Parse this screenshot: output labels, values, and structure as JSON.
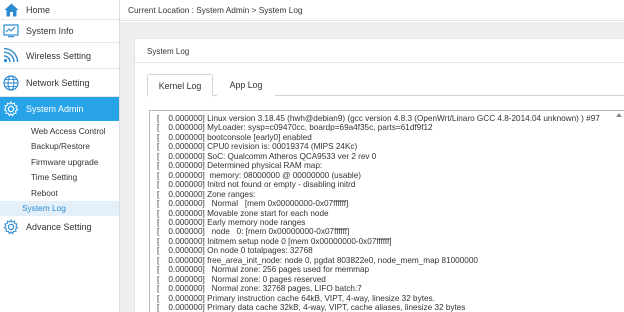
{
  "sidebar": {
    "items": [
      {
        "label": "Home",
        "icon": "home-icon"
      },
      {
        "label": "System Info",
        "icon": "monitor-icon"
      },
      {
        "label": "Wireless Setting",
        "icon": "wifi-icon"
      },
      {
        "label": "Network Setting",
        "icon": "globe-icon"
      },
      {
        "label": "System Admin",
        "icon": "gear-icon"
      }
    ],
    "subitems": [
      {
        "label": "Web Access Control"
      },
      {
        "label": "Backup/Restore"
      },
      {
        "label": "Firmware upgrade"
      },
      {
        "label": "Time Setting"
      },
      {
        "label": "Reboot"
      },
      {
        "label": "System Log"
      }
    ],
    "advanced": {
      "label": "Advance Setting",
      "icon": "gear-icon"
    },
    "accent_color": "#29a3e8"
  },
  "header": {
    "breadcrumb": "Current Location : System Admin > System Log"
  },
  "panel": {
    "title": "System Log",
    "tabs": [
      {
        "label": "Kernel Log"
      },
      {
        "label": "App Log"
      }
    ]
  },
  "log": {
    "lines": [
      "[    0.000000] Linux version 3.18.45 (hwh@debian9) (gcc version 4.8.3 (OpenWrt/Linaro GCC 4.8-2014.04 unknown) ) #97",
      "[    0.000000] MyLoader: sysp=c09470cc, boardp=69a4f35c, parts=61df9f12",
      "[    0.000000] bootconsole [early0] enabled",
      "[    0.000000] CPU0 revision is: 00019374 (MIPS 24Kc)",
      "[    0.000000] SoC: Qualcomm Atheros QCA9533 ver 2 rev 0",
      "[    0.000000] Determined physical RAM map:",
      "[    0.000000]  memory: 08000000 @ 00000000 (usable)",
      "[    0.000000] Initrd not found or empty - disabling initrd",
      "[    0.000000] Zone ranges:",
      "[    0.000000]   Normal   [mem 0x00000000-0x07ffffff]",
      "[    0.000000] Movable zone start for each node",
      "[    0.000000] Early memory node ranges",
      "[    0.000000]   node   0: [mem 0x00000000-0x07ffffff]",
      "[    0.000000] Initmem setup node 0 [mem 0x00000000-0x07ffffff]",
      "[    0.000000] On node 0 totalpages: 32768",
      "[    0.000000] free_area_init_node: node 0, pgdat 803822e0, node_mem_map 81000000",
      "[    0.000000]   Normal zone: 256 pages used for memmap",
      "[    0.000000]   Normal zone: 0 pages reserved",
      "[    0.000000]   Normal zone: 32768 pages, LIFO batch:7",
      "[    0.000000] Primary instruction cache 64kB, VIPT, 4-way, linesize 32 bytes.",
      "[    0.000000] Primary data cache 32kB, 4-way, VIPT, cache aliases, linesize 32 bytes"
    ]
  }
}
